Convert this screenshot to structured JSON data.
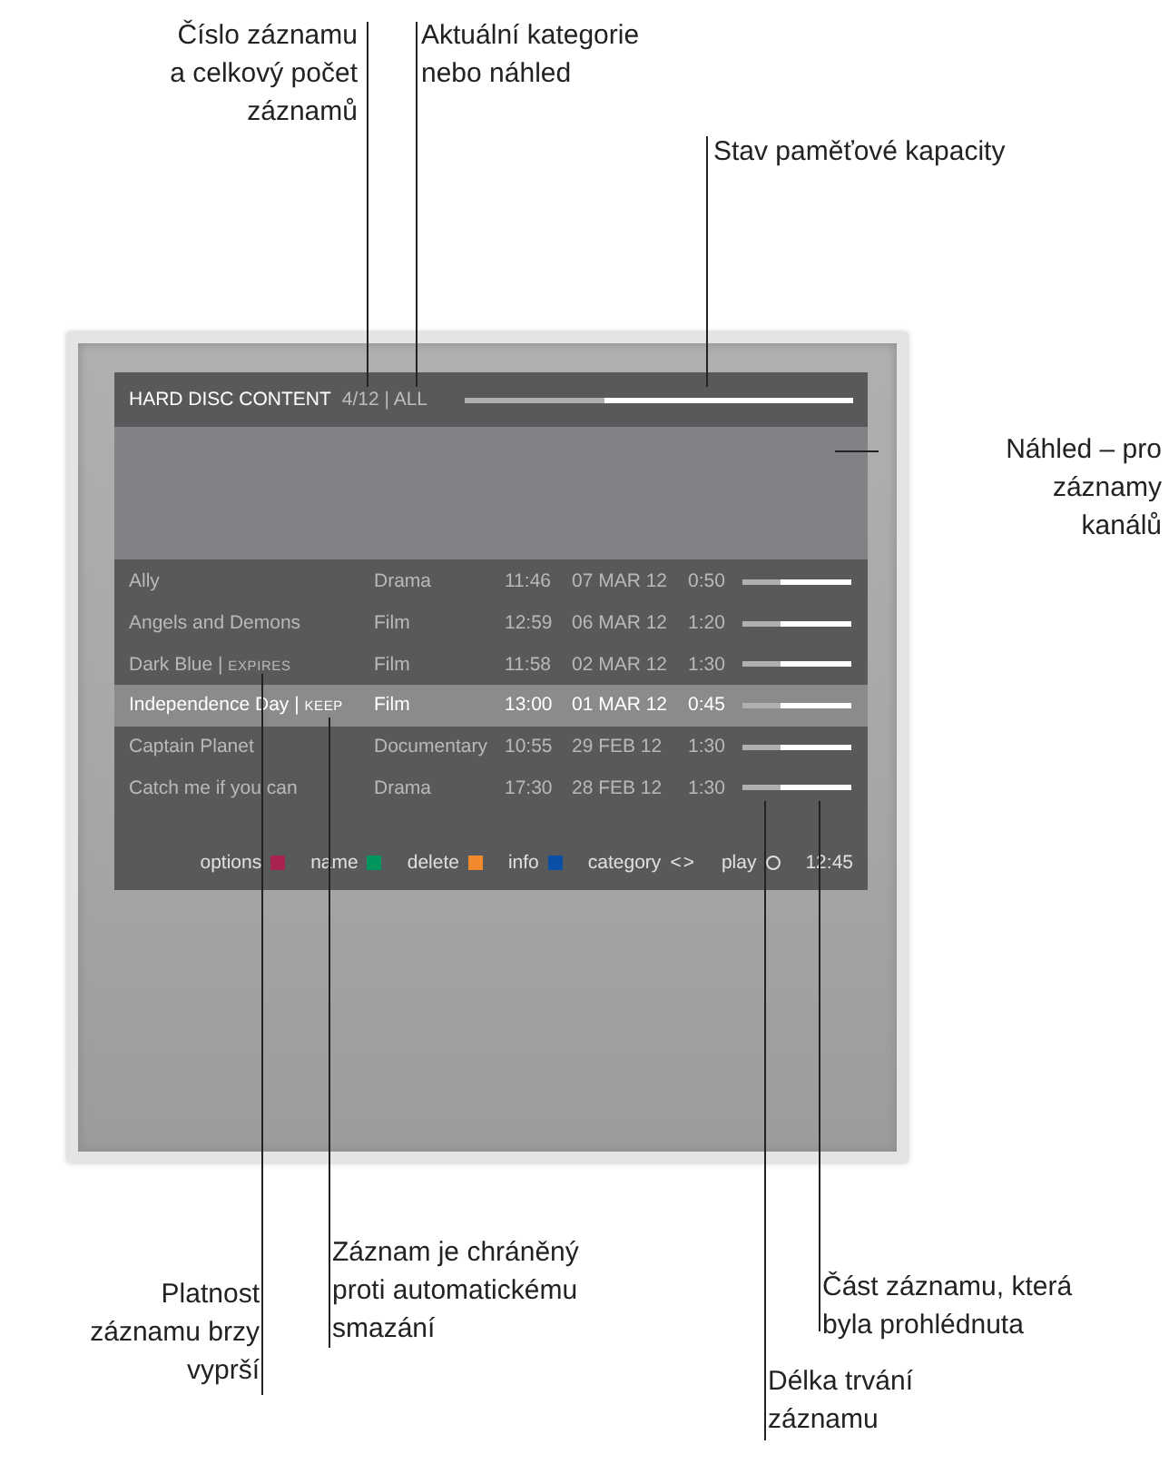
{
  "screen": {
    "title": "HARD DISC CONTENT",
    "counter": "4/12 | ALL",
    "capacity": {
      "level": 0.36
    },
    "recordings": [
      {
        "title": "Ally",
        "genre": "Drama",
        "time": "11:46",
        "date": "07 MAR 12",
        "duration": "0:50",
        "level": 0.35,
        "selected": false
      },
      {
        "title": "Angels and Demons",
        "genre": "Film",
        "time": "12:59",
        "date": "06 MAR 12",
        "duration": "1:20",
        "level": 0.35,
        "selected": false
      },
      {
        "title": "Dark Blue |",
        "tag": "EXPIRES",
        "genre": "Film",
        "time": "11:58",
        "date": "02 MAR 12",
        "duration": "1:30",
        "level": 0.35,
        "selected": false
      },
      {
        "title": "Independence Day |",
        "tag": "KEEP",
        "genre": "Film",
        "time": "13:00",
        "date": "01 MAR 12",
        "duration": "0:45",
        "level": 0.35,
        "selected": true
      },
      {
        "title": "Captain Planet",
        "genre": "Documentary",
        "time": "10:55",
        "date": "29 FEB 12",
        "duration": "1:30",
        "level": 0.35,
        "selected": false
      },
      {
        "title": "Catch me if you can",
        "genre": "Drama",
        "time": "17:30",
        "date": "28 FEB 12",
        "duration": "1:30",
        "level": 0.35,
        "selected": false
      }
    ],
    "keys": [
      {
        "label": "options",
        "kind": "color",
        "color": "#a8234f"
      },
      {
        "label": "name",
        "kind": "color",
        "color": "#00965e"
      },
      {
        "label": "delete",
        "kind": "color",
        "color": "#f08a2c"
      },
      {
        "label": "info",
        "kind": "color",
        "color": "#0a4fa8"
      },
      {
        "label": "category",
        "kind": "symbol",
        "symbol": "<>"
      },
      {
        "label": "play",
        "kind": "circle"
      }
    ],
    "clock": "12:45"
  },
  "callouts": [
    {
      "lines": [
        "Číslo záznamu",
        "a celkový počet",
        "záznamů"
      ]
    },
    {
      "lines": [
        "Aktuální kategorie",
        "nebo náhled"
      ]
    },
    {
      "lines": [
        "Stav paměťové kapacity"
      ]
    },
    {
      "lines": [
        "Náhled – pro",
        "záznamy",
        "kanálů"
      ]
    },
    {
      "lines": [
        "Platnost",
        "záznamu brzy",
        "vyprší"
      ]
    },
    {
      "lines": [
        "Záznam je chráněný",
        "proti automatickému",
        "smazání"
      ]
    },
    {
      "lines": [
        "Část záznamu, která",
        "byla prohlédnuta"
      ]
    },
    {
      "lines": [
        "Délka trvání",
        "záznamu"
      ]
    }
  ]
}
